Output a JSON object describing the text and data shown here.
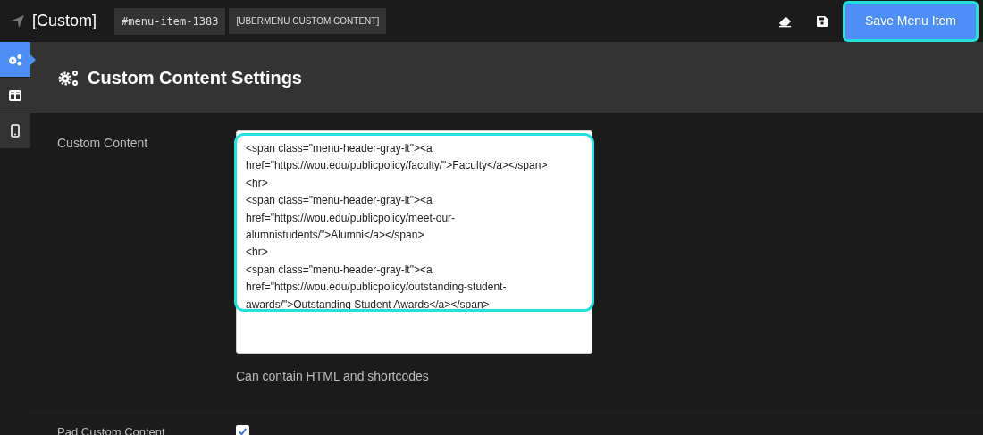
{
  "toolbar": {
    "title": "[Custom]",
    "item_id": "#menu-item-1383",
    "item_type": "[UBERMENU CUSTOM CONTENT]",
    "save_button": "Save Menu Item"
  },
  "sidebar": {
    "items": [
      {
        "kind": "settings",
        "selected": true
      },
      {
        "kind": "layout",
        "selected": false
      },
      {
        "kind": "mobile",
        "selected": false
      }
    ]
  },
  "panel": {
    "title": "Custom Content Settings"
  },
  "fields": [
    {
      "kind": "textarea",
      "label": "Custom Content",
      "value": "<span class=\"menu-header-gray-lt\"><a href=\"https://wou.edu/publicpolicy/faculty/\">Faculty</a></span>\n<hr>\n<span class=\"menu-header-gray-lt\"><a href=\"https://wou.edu/publicpolicy/meet-our-alumnistudents/\">Alumni</a></span>\n<hr>\n<span class=\"menu-header-gray-lt\"><a href=\"https://wou.edu/publicpolicy/outstanding-student-awards/\">Outstanding Student Awards</a></span>",
      "help": "Can contain HTML and shortcodes"
    },
    {
      "kind": "checkbox",
      "label": "Pad Custom Content",
      "checked": true
    }
  ]
}
